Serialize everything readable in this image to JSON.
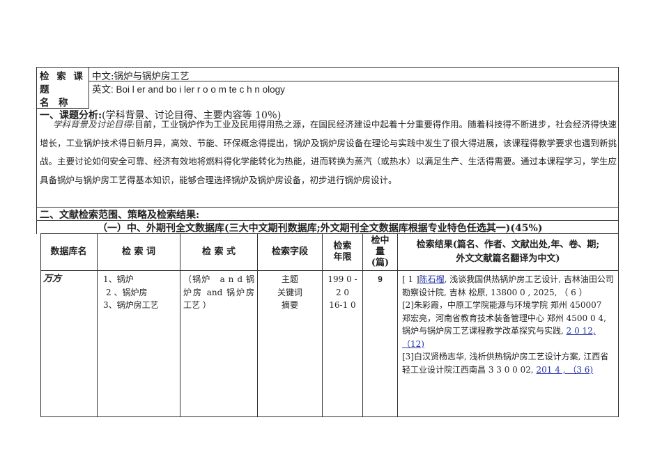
{
  "title_row": {
    "label": [
      "检 索 课",
      "题",
      "名　称"
    ],
    "chinese": "中文:锅炉与锅炉房工艺",
    "english": "英文: Boi l er and bo i ler r o o m te c h n ology"
  },
  "section1": {
    "heading": "一、课题分析:",
    "heading_note": "(学科背景、讨论目得、主要内容等 10％)",
    "lead": "学科背景及讨论目得:",
    "body": "目前，工业锅炉作为工业及民用得用热之源，在国民经济建设中起着十分重要得作用。随着科技得不断进步，社会经济得快速增长，工业锅炉技术得日新月异，高效、节能、环保概念得提出，锅炉及锅炉房设备在理论与实践中发生了很大得进展，该课程得教学要求也遇到新挑战。主要讨论如何安全可靠、经济有效地将燃料得化学能转化为热能，进而转换为蒸汽（或热水）以满足生产、生活得需要。通过本课程学习，学生应具备锅炉与锅炉房工艺得基本知识，能够合理选择锅炉及锅炉房设备，初步进行锅炉房设计。"
  },
  "section2": {
    "heading": "二、文献检索范围、策略及检索结果:",
    "sub": "（一）中、外期刊全文数据库(三大中文期刊数据库;外文期刊全文数据库根据专业特色任选其一)(45%)"
  },
  "table": {
    "headers": [
      "数据库名",
      "检 索 词",
      "检 索 式",
      "检索字段",
      "检索\n年限",
      "检中\n量\n(篇)",
      "检索结果(篇名、作者、文献出处,年、卷、期; 外文文献篇名翻译为中文)"
    ],
    "row": {
      "db": "万方",
      "terms": [
        "1、锅炉",
        "2 、锅炉房",
        "3、锅炉房工艺"
      ],
      "query": "（锅炉　a n d 锅炉房 and 锅炉房工艺 ）",
      "fields": [
        "主题",
        "关键词",
        "摘要"
      ],
      "years": [
        "199 0 -",
        "2 0",
        "16-1 0"
      ],
      "count": "9",
      "results": {
        "r1_prefix": "[ 1 ]",
        "r1_author": "陈石榴",
        "r1_rest": ", 浅谈我国供热锅炉房工艺设计, 吉林油田公司勘察设计院, 吉林 松原, 13800 0 , 2025, （ 6 ）",
        "r2_a": "[2]朱彩霞，中原工学院能源与环境学院 郑州 450007",
        "r2_b": "郑宏亮，河南省教育技术装备管理中心 郑州 4500 0 4,",
        "r2_c": "锅炉与锅炉房工艺课程教学改革探究与实践,",
        "r2_link": "2 0 12, （12)",
        "r3_a": "[3]白汉贤杨志华, 浅析供热锅炉房工艺设计方案, 江西省轻工业设计院江西南昌 3 3 0 0 02,",
        "r3_link": "201 4 , （3 6)"
      }
    }
  },
  "colors": {
    "border": "#333333",
    "link": "#2233aa"
  }
}
